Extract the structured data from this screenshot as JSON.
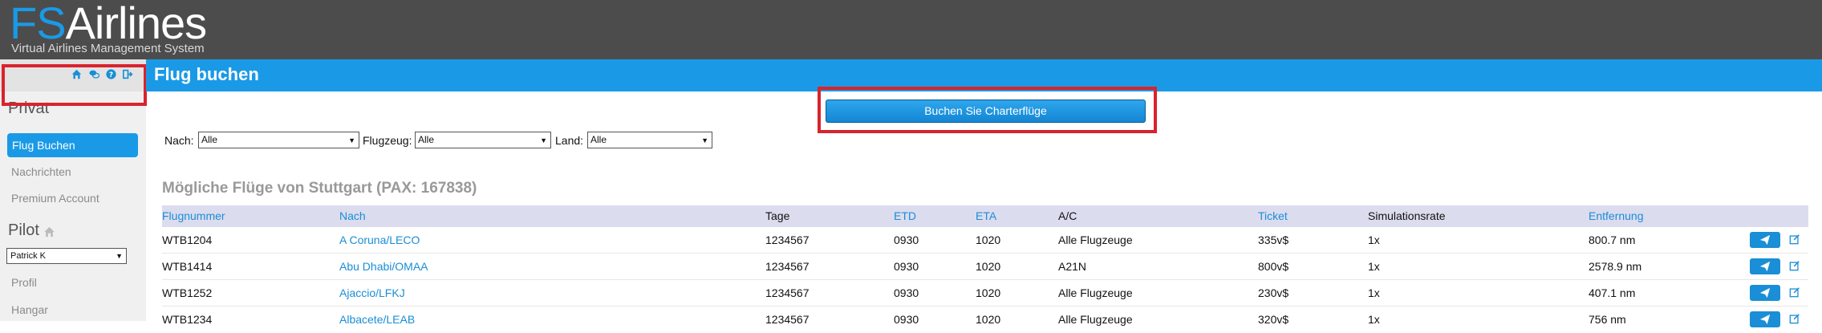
{
  "header": {
    "logo_fs": "FS",
    "logo_rest": "Airlines",
    "subtitle": "Virtual Airlines Management System"
  },
  "sidebar": {
    "icons": [
      "home-icon",
      "comments-icon",
      "question-icon",
      "logout-icon"
    ],
    "privat_heading": "Privat",
    "items": [
      {
        "label": "Flug Buchen",
        "active": true
      },
      {
        "label": "Nachrichten"
      },
      {
        "label": "Premium Account"
      }
    ],
    "pilot_heading": "Pilot",
    "pilot_selected": "Patrick K",
    "pilot_items": [
      {
        "label": "Profil"
      },
      {
        "label": "Hangar"
      }
    ]
  },
  "page": {
    "title": "Flug buchen",
    "charter_button": "Buchen Sie Charterflüge"
  },
  "filters": {
    "nach_label": "Nach:",
    "nach_value": "Alle",
    "flugzeug_label": "Flugzeug:",
    "flugzeug_value": "Alle",
    "land_label": "Land:",
    "land_value": "Alle"
  },
  "section_title": "Mögliche Flüge von Stuttgart (PAX: 167838)",
  "table": {
    "columns": [
      "Flugnummer",
      "Nach",
      "Tage",
      "ETD",
      "ETA",
      "A/C",
      "Ticket",
      "Simulationsrate",
      "Entfernung"
    ],
    "rows": [
      {
        "flight": "WTB1204",
        "to": "A Coruna/LECO",
        "days": "1234567",
        "etd": "0930",
        "eta": "1020",
        "ac": "Alle Flugzeuge",
        "ticket": "335v$",
        "sim": "1x",
        "dist": "800.7 nm"
      },
      {
        "flight": "WTB1414",
        "to": "Abu Dhabi/OMAA",
        "days": "1234567",
        "etd": "0930",
        "eta": "1020",
        "ac": "A21N",
        "ticket": "800v$",
        "sim": "1x",
        "dist": "2578.9 nm"
      },
      {
        "flight": "WTB1252",
        "to": "Ajaccio/LFKJ",
        "days": "1234567",
        "etd": "0930",
        "eta": "1020",
        "ac": "Alle Flugzeuge",
        "ticket": "230v$",
        "sim": "1x",
        "dist": "407.1 nm"
      },
      {
        "flight": "WTB1234",
        "to": "Albacete/LEAB",
        "days": "1234567",
        "etd": "0930",
        "eta": "1020",
        "ac": "Alle Flugzeuge",
        "ticket": "320v$",
        "sim": "1x",
        "dist": "756 nm"
      }
    ]
  },
  "colors": {
    "accent": "#1a9ae6",
    "header_bg": "#4c4c4c",
    "highlight_box": "#d9232d"
  }
}
